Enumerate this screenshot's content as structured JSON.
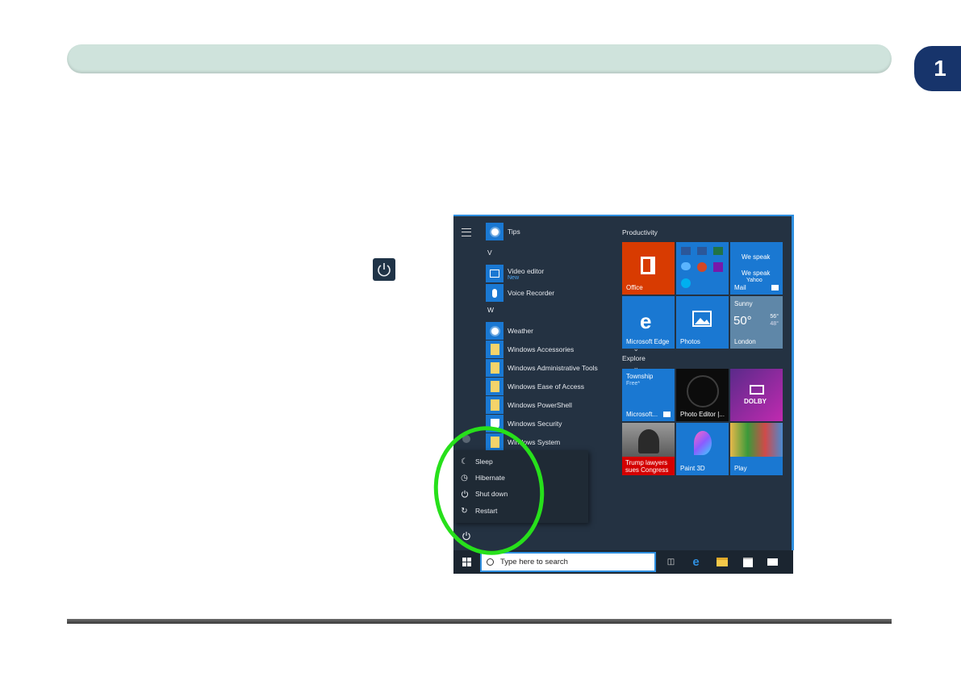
{
  "chapter": {
    "number": "1"
  },
  "start_menu": {
    "apps": [
      {
        "label": "Tips",
        "icon": "tips-icon"
      },
      {
        "section": "V"
      },
      {
        "label": "Video editor",
        "sublabel": "New",
        "icon": "video-editor-icon"
      },
      {
        "label": "Voice Recorder",
        "icon": "microphone-icon"
      },
      {
        "section": "W"
      },
      {
        "label": "Weather",
        "icon": "weather-icon"
      },
      {
        "label": "Windows Accessories",
        "icon": "folder-icon",
        "expandable": true
      },
      {
        "label": "Windows Administrative Tools",
        "icon": "folder-icon",
        "expandable": true
      },
      {
        "label": "Windows Ease of Access",
        "icon": "folder-icon",
        "expandable": true
      },
      {
        "label": "Windows PowerShell",
        "icon": "folder-icon",
        "expandable": true
      },
      {
        "label": "Windows Security",
        "icon": "shield-icon"
      },
      {
        "label": "Windows System",
        "icon": "folder-icon",
        "expandable": true
      }
    ],
    "groups": {
      "productivity": "Productivity",
      "explore": "Explore"
    },
    "tiles": {
      "office": "Office",
      "mail": "Mail",
      "mail_line1": "We speak",
      "mail_line2": "Yahoo",
      "edge": "Microsoft Edge",
      "photos": "Photos",
      "weather_cond": "Sunny",
      "weather_temp": "50°",
      "weather_hi": "56°",
      "weather_lo": "48°",
      "weather_city": "London",
      "township": "Township",
      "township_price": "Free*",
      "store": "Microsoft...",
      "photo_editor": "Photo Editor |...",
      "dolby": "DOLBY",
      "news_line1": "Trump lawyers",
      "news_line2": "sues Congress",
      "paint3d": "Paint 3D",
      "play": "Play"
    },
    "power_menu": [
      {
        "label": "Sleep",
        "icon": "moon-icon"
      },
      {
        "label": "Hibernate",
        "icon": "clock-icon"
      },
      {
        "label": "Shut down",
        "icon": "power-icon"
      },
      {
        "label": "Restart",
        "icon": "restart-icon"
      }
    ]
  },
  "taskbar": {
    "search_placeholder": "Type here to search"
  },
  "colors": {
    "accent": "#1a78d2",
    "menu_bg": "#243242",
    "highlight_ring": "#27e01b",
    "header_bar": "#cfe3dc",
    "chapter_tab": "#17346b"
  }
}
